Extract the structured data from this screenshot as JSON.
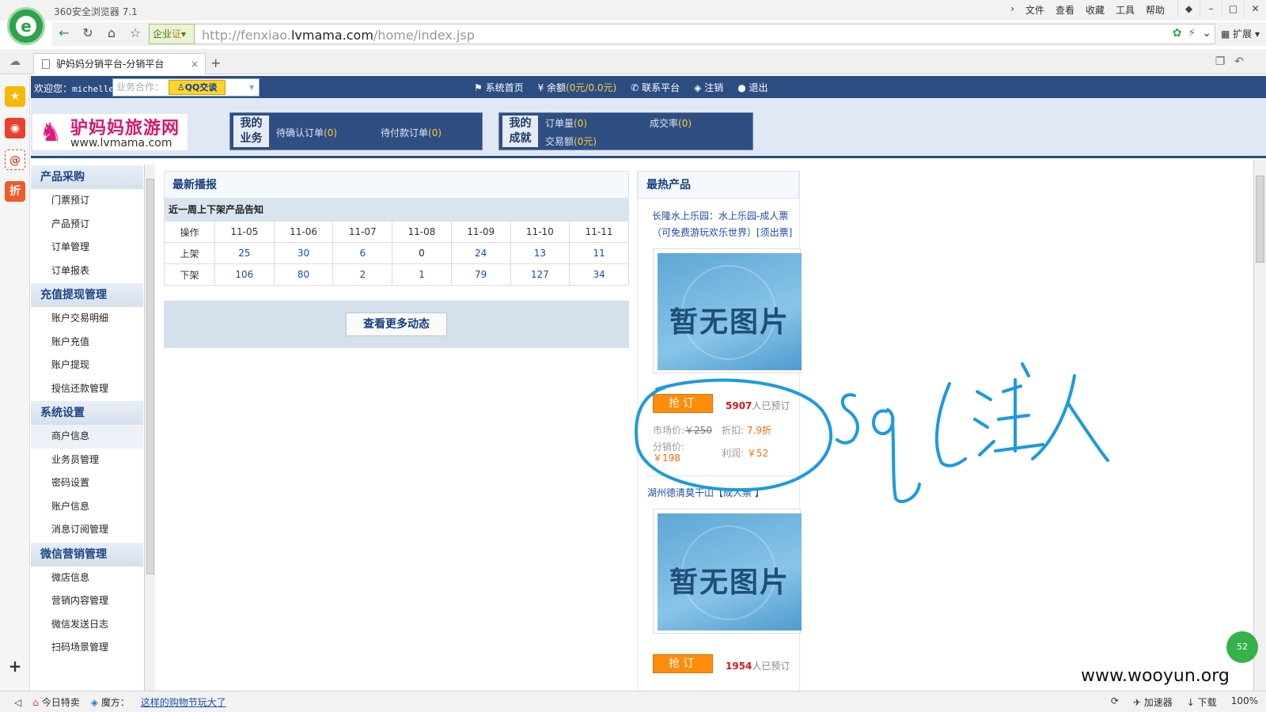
{
  "browser": {
    "title": "360安全浏览器 7.1",
    "menu": [
      "文件",
      "查看",
      "收藏",
      "工具",
      "帮助"
    ],
    "url_prefix": "http://fenxiao.",
    "url_domain": "lvmama.com",
    "url_path": "/home/index.jsp",
    "badge": "企业",
    "badge_cert": "证",
    "extend": "扩展",
    "tab_title": "驴妈妈分销平台-分销平台",
    "status_today": "今日特卖",
    "status_magic": "魔方：",
    "status_link": "这样的购物节玩大了",
    "status_accel": "加速器",
    "status_download": "下载",
    "zoom": "100%",
    "watermark": "www.wooyun.org",
    "bubble": "52"
  },
  "topnav": {
    "welcome": "欢迎您：",
    "user": "michelle",
    "biz_placeholder": "业务合作：",
    "qq": "QQ交谈",
    "home": "系统首页",
    "balance_label": "余额",
    "balance_value": "(0元/0.0元)",
    "contact": "联系平台",
    "logout_account": "注销",
    "exit": "退出"
  },
  "header": {
    "logo_cn": "驴妈妈旅游网",
    "logo_en": "www.lvmama.com",
    "biz_label_1": "我的",
    "biz_label_2": "业务",
    "pending_confirm": "待确认订单",
    "pending_confirm_count": "(0)",
    "pending_pay": "待付款订单",
    "pending_pay_count": "(0)",
    "ach_label_1": "我的",
    "ach_label_2": "成就",
    "order_count": "订单量",
    "order_count_val": "(0)",
    "deal_rate": "成交率",
    "deal_rate_val": "(0)",
    "turnover": "交易额",
    "turnover_val": "(0元)"
  },
  "sidebar": {
    "groups": [
      {
        "title": "产品采购",
        "items": [
          "门票预订",
          "产品预订",
          "订单管理",
          "订单报表"
        ]
      },
      {
        "title": "充值提现管理",
        "items": [
          "账户交易明细",
          "账户充值",
          "账户提现",
          "授信还款管理"
        ]
      },
      {
        "title": "系统设置",
        "items": [
          "商户信息",
          "业务员管理",
          "密码设置",
          "账户信息",
          "消息订阅管理"
        ]
      },
      {
        "title": "微信营销管理",
        "items": [
          "微店信息",
          "营销内容管理",
          "微信发送日志",
          "扫码场景管理"
        ]
      }
    ]
  },
  "news": {
    "title": "最新播报",
    "subtitle": "近一周上下架产品告知",
    "header": [
      "操作",
      "11-05",
      "11-06",
      "11-07",
      "11-08",
      "11-09",
      "11-10",
      "11-11"
    ],
    "rows": [
      [
        "上架",
        "25",
        "30",
        "6",
        "0",
        "24",
        "13",
        "11"
      ],
      [
        "下架",
        "106",
        "80",
        "2",
        "1",
        "79",
        "127",
        "34"
      ]
    ],
    "more": "查看更多动态"
  },
  "hot": {
    "title": "最热产品",
    "products": [
      {
        "name": "长隆水上乐园：水上乐园-成人票（可免费游玩欢乐世界）[须出票]",
        "image_text": "暂无图片",
        "buy": "抢订",
        "booked_count": "5907",
        "booked_suffix": "人已预订",
        "market_label": "市场价:",
        "market_price": "￥250",
        "discount_label": "折扣:",
        "discount": "7.9折",
        "dist_label": "分销价:",
        "dist_price": "￥198",
        "profit_label": "利润:",
        "profit": "￥52"
      },
      {
        "name": "湖州德清莫干山【成人票 】",
        "image_text": "暂无图片",
        "buy": "抢订",
        "booked_count": "1954",
        "booked_suffix": "人已预订"
      }
    ]
  },
  "colors": {
    "nav_blue": "#2b4d82",
    "accent_orange": "#ff8c0a",
    "annotation_blue": "#1b9ae0"
  }
}
